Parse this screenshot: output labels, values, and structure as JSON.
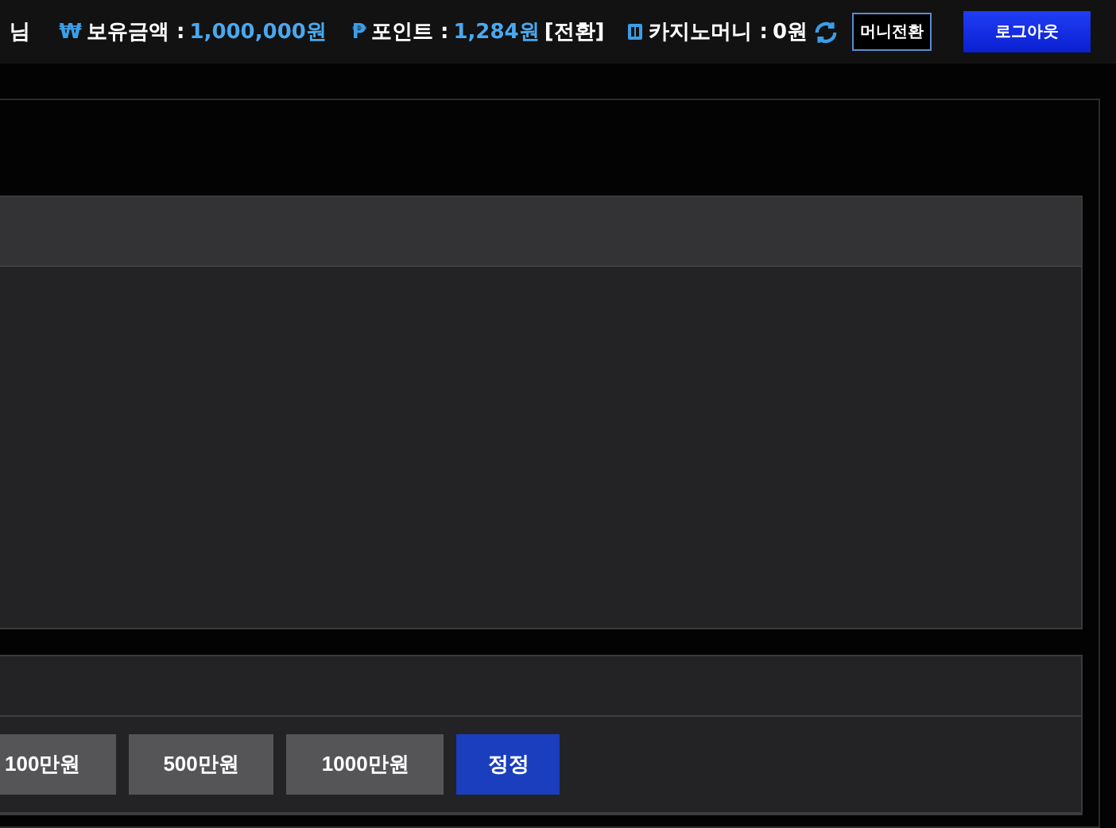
{
  "header": {
    "user_suffix": "님",
    "balance": {
      "symbol": "₩",
      "label": "보유금액 :",
      "value": "1,000,000원"
    },
    "points": {
      "symbol": "₱",
      "label": "포인트 :",
      "value": "1,284원",
      "action": "[전환]"
    },
    "casino": {
      "label": "카지노머니 :",
      "value": "0원"
    },
    "buttons": [
      {
        "label": "머니전환",
        "kind": "outline"
      },
      {
        "label": "로그아웃",
        "kind": "primary"
      }
    ]
  },
  "amount_buttons": [
    {
      "label": "100만원",
      "kind": "amount"
    },
    {
      "label": "500만원",
      "kind": "amount"
    },
    {
      "label": "1000만원",
      "kind": "amount"
    },
    {
      "label": "정정",
      "kind": "reset"
    }
  ]
}
